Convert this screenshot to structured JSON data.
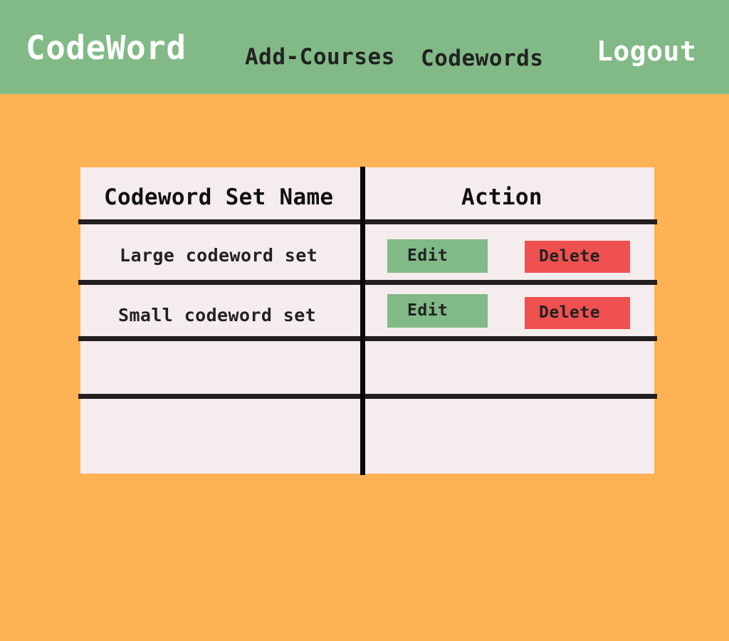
{
  "navbar": {
    "brand": "CodeWord",
    "links": [
      {
        "label": "Add-Courses"
      },
      {
        "label": "Codewords"
      }
    ],
    "logout_label": "Logout"
  },
  "table": {
    "headers": [
      "Codeword Set Name",
      "Action"
    ],
    "rows": [
      {
        "name": "Large codeword set",
        "edit_label": "Edit",
        "delete_label": "Delete"
      },
      {
        "name": "Small codeword set",
        "edit_label": "Edit",
        "delete_label": "Delete"
      },
      {
        "name": "",
        "edit_label": "",
        "delete_label": ""
      },
      {
        "name": "",
        "edit_label": "",
        "delete_label": ""
      }
    ]
  },
  "colors": {
    "page_background": "#FDB254",
    "navbar": "#81BA86",
    "table_background": "#F4ECED",
    "edit_button": "#81BA86",
    "delete_button": "#EF5050",
    "grid_lines": "#231F1E"
  }
}
